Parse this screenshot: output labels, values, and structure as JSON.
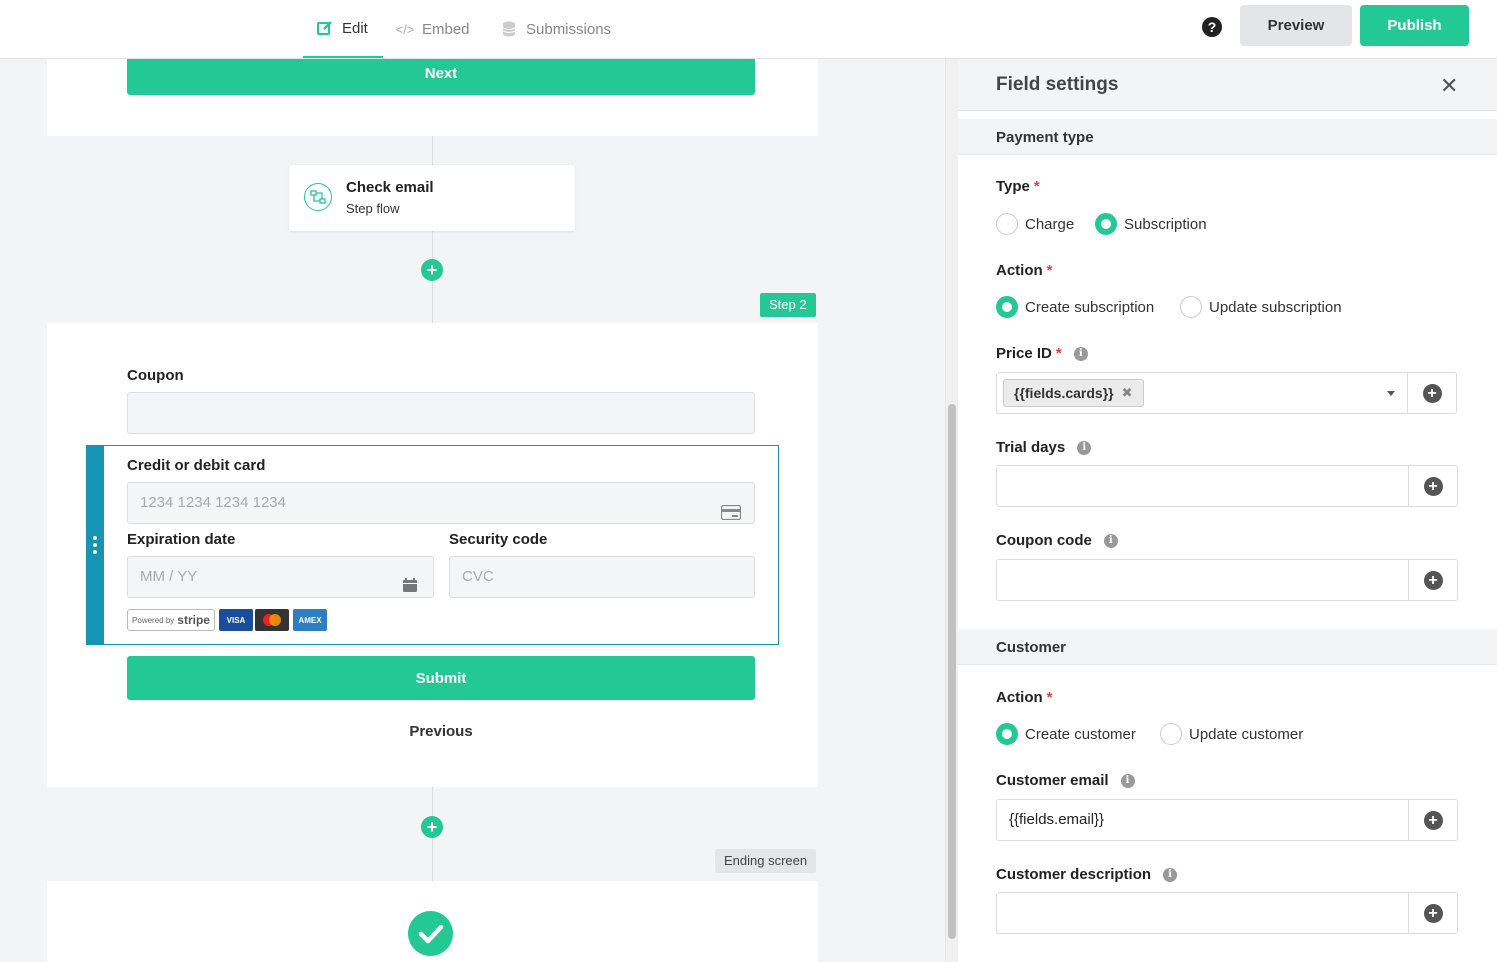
{
  "topbar": {
    "tabs": [
      {
        "label": "Edit",
        "icon": "edit-icon",
        "active": true
      },
      {
        "label": "Embed",
        "icon": "code-icon",
        "active": false
      },
      {
        "label": "Submissions",
        "icon": "database-icon",
        "active": false
      }
    ],
    "help": "?",
    "preview_label": "Preview",
    "publish_label": "Publish"
  },
  "canvas": {
    "next_label": "Next",
    "step_flow": {
      "title": "Check email",
      "subtitle": "Step flow"
    },
    "step2_badge": "Step 2",
    "coupon_label": "Coupon",
    "card_label": "Credit or debit card",
    "card_placeholder": "1234 1234 1234 1234",
    "exp_label": "Expiration date",
    "exp_placeholder": "MM / YY",
    "sec_label": "Security code",
    "sec_placeholder": "CVC",
    "stripe_powered": "Powered by",
    "stripe_brand": "stripe",
    "card_brands": [
      "VISA",
      "MC",
      "AMEX"
    ],
    "submit_label": "Submit",
    "previous_label": "Previous",
    "ending_badge": "Ending screen"
  },
  "panel": {
    "title": "Field settings",
    "payment_section": "Payment type",
    "type_label": "Type",
    "type_options": [
      {
        "label": "Charge",
        "selected": false
      },
      {
        "label": "Subscription",
        "selected": true
      }
    ],
    "action_label": "Action",
    "action_options": [
      {
        "label": "Create subscription",
        "selected": true
      },
      {
        "label": "Update subscription",
        "selected": false
      }
    ],
    "price_label": "Price ID",
    "price_tag": "{{fields.cards}}",
    "trial_label": "Trial days",
    "trial_value": "",
    "coupon_label": "Coupon code",
    "coupon_value": "",
    "customer_section": "Customer",
    "cust_action_label": "Action",
    "cust_action_options": [
      {
        "label": "Create customer",
        "selected": true
      },
      {
        "label": "Update customer",
        "selected": false
      }
    ],
    "email_label": "Customer email",
    "email_value": "{{fields.email}}",
    "desc_label": "Customer description",
    "desc_value": ""
  },
  "colors": {
    "accent": "#24c895",
    "focus": "#1594b3",
    "required": "#e23d3d"
  }
}
